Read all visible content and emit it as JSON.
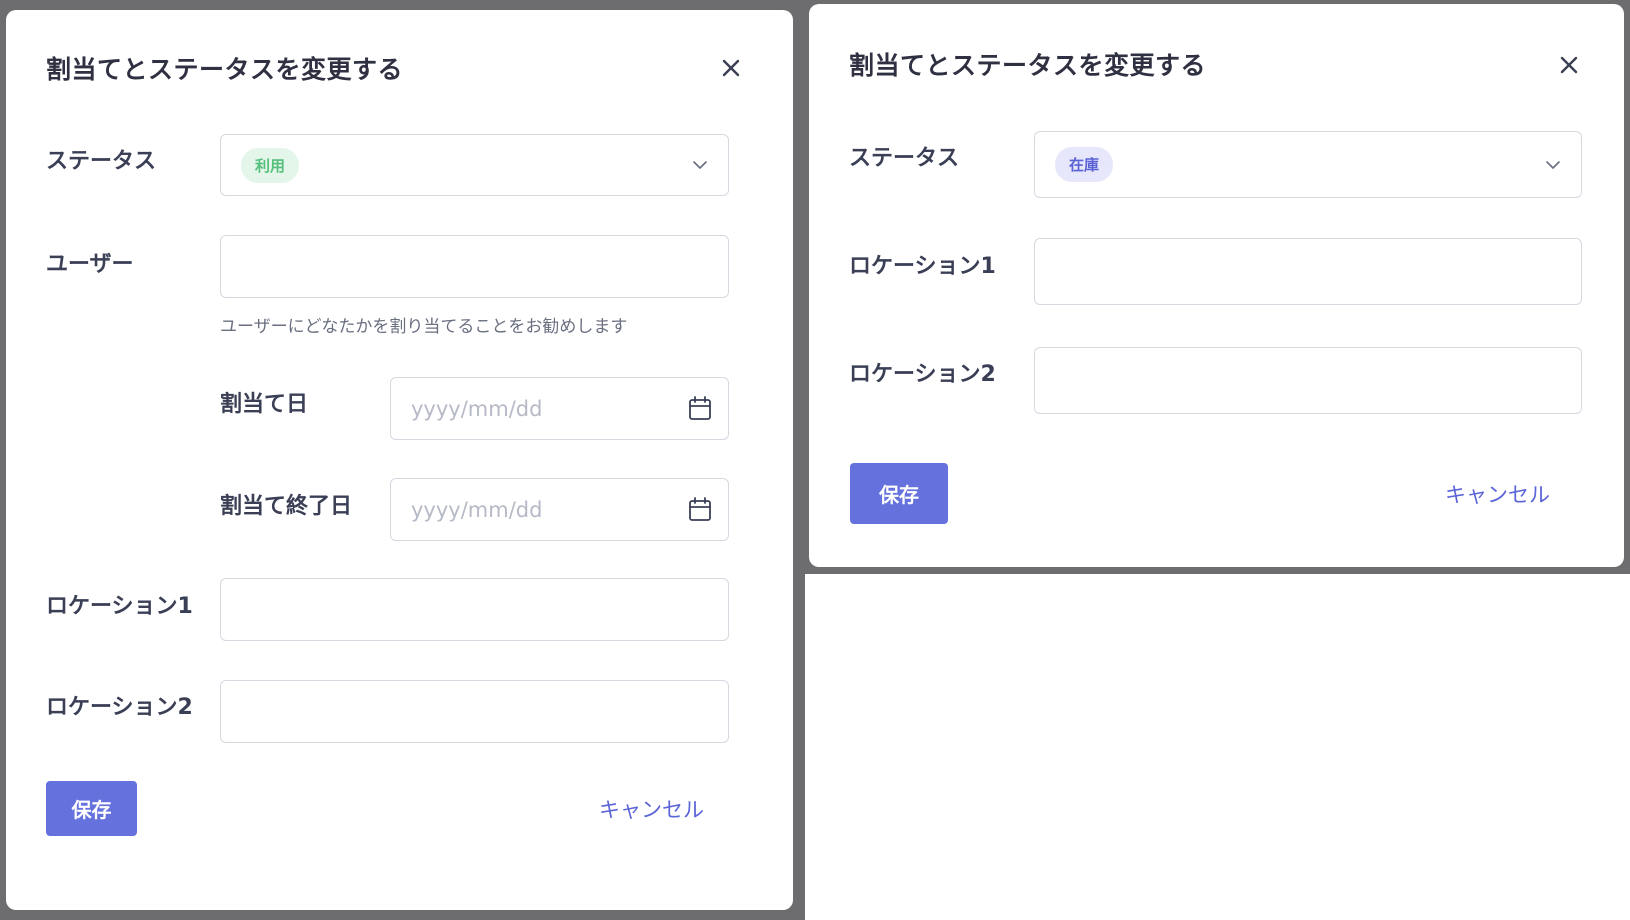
{
  "left_dialog": {
    "title": "割当てとステータスを変更する",
    "close_icon": "close-icon",
    "status_label": "ステータス",
    "status_value": "利用",
    "user_label": "ユーザー",
    "user_value": "",
    "user_help": "ユーザーにどなたかを割り当てることをお勧めします",
    "assign_date_label": "割当て日",
    "assign_date_placeholder": "yyyy/mm/dd",
    "assign_end_date_label": "割当て終了日",
    "assign_end_date_placeholder": "yyyy/mm/dd",
    "location1_label": "ロケーション1",
    "location1_value": "",
    "location2_label": "ロケーション2",
    "location2_value": "",
    "save_label": "保存",
    "cancel_label": "キャンセル"
  },
  "right_dialog": {
    "title": "割当てとステータスを変更する",
    "close_icon": "close-icon",
    "status_label": "ステータス",
    "status_value": "在庫",
    "location1_label": "ロケーション1",
    "location1_value": "",
    "location2_label": "ロケーション2",
    "location2_value": "",
    "save_label": "保存",
    "cancel_label": "キャンセル"
  },
  "colors": {
    "primary": "#6571dd",
    "status_in_use": "#56c07d",
    "status_in_stock": "#5b62d6",
    "overlay": "#6d6d70"
  },
  "icons": [
    "close-icon",
    "chevron-down-icon",
    "calendar-icon"
  ]
}
